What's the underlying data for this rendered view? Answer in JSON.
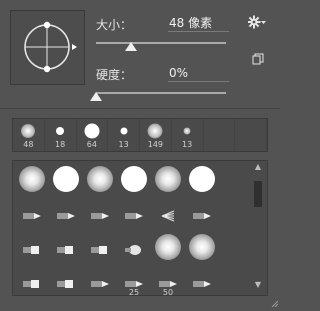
{
  "brush": {
    "size_label": "大小：",
    "size_value": "48 像素",
    "size_fraction": 0.27,
    "hardness_label": "硬度：",
    "hardness_value": "0%",
    "hardness_fraction": 0.0
  },
  "icons": {
    "settings": "gear-icon",
    "menu": "chevron-down-icon",
    "new_preset": "new-preset-icon",
    "angle_handle": "angle-arrow-icon"
  },
  "recent": [
    {
      "size": "48",
      "kind": "soft"
    },
    {
      "size": "18",
      "kind": "hard"
    },
    {
      "size": "64",
      "kind": "hard"
    },
    {
      "size": "13",
      "kind": "hard"
    },
    {
      "size": "149",
      "kind": "soft"
    },
    {
      "size": "13",
      "kind": "soft"
    }
  ],
  "presets": [
    [
      {
        "kind": "soft",
        "size": ""
      },
      {
        "kind": "hard",
        "size": ""
      },
      {
        "kind": "soft",
        "size": ""
      },
      {
        "kind": "hard",
        "size": ""
      },
      {
        "kind": "soft",
        "size": ""
      },
      {
        "kind": "hard",
        "size": ""
      }
    ],
    [
      {
        "kind": "stroke",
        "size": ""
      },
      {
        "kind": "stroke",
        "size": ""
      },
      {
        "kind": "stroke",
        "size": ""
      },
      {
        "kind": "stroke",
        "size": ""
      },
      {
        "kind": "fan",
        "size": ""
      },
      {
        "kind": "stroke",
        "size": ""
      }
    ],
    [
      {
        "kind": "block",
        "size": ""
      },
      {
        "kind": "block",
        "size": ""
      },
      {
        "kind": "block",
        "size": ""
      },
      {
        "kind": "round",
        "size": ""
      },
      {
        "kind": "soft",
        "size": ""
      },
      {
        "kind": "soft",
        "size": ""
      }
    ],
    [
      {
        "kind": "block",
        "size": ""
      },
      {
        "kind": "block",
        "size": ""
      },
      {
        "kind": "stroke",
        "size": ""
      },
      {
        "kind": "stroke",
        "size": "25"
      },
      {
        "kind": "stroke",
        "size": "50"
      },
      {
        "kind": "stroke",
        "size": ""
      }
    ]
  ],
  "colors": {
    "panel_bg": "#535353",
    "well_bg": "#4a4a4a",
    "text": "#e6e6e6"
  }
}
